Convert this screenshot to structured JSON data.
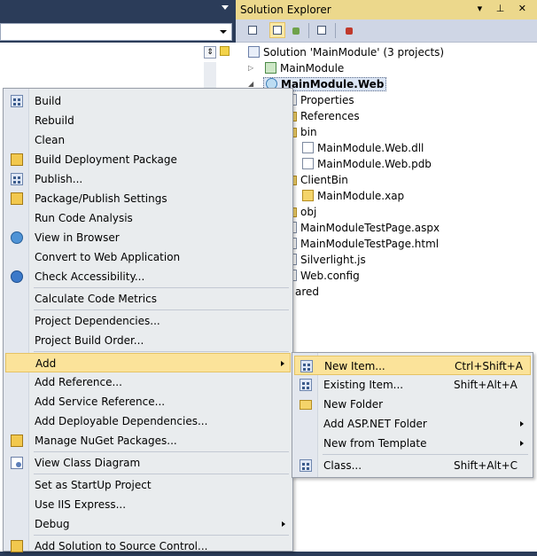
{
  "solution_explorer": {
    "title": "Solution Explorer",
    "title_buttons": "▾ ⊥ ✕",
    "tree": [
      {
        "label": "Solution 'MainModule' (3 projects)",
        "icon": "solution-icon"
      },
      {
        "label": "MainModule",
        "icon": "csharp-project-icon"
      },
      {
        "label": "MainModule.Web",
        "icon": "web-project-icon"
      },
      {
        "label": "Properties",
        "icon": "properties-icon"
      },
      {
        "label": "References",
        "icon": "references-icon"
      },
      {
        "label": "bin",
        "icon": "folder-icon"
      },
      {
        "label": "MainModule.Web.dll",
        "icon": "file-icon"
      },
      {
        "label": "MainModule.Web.pdb",
        "icon": "file-icon"
      },
      {
        "label": "ClientBin",
        "icon": "folder-icon"
      },
      {
        "label": "MainModule.xap",
        "icon": "xap-icon"
      },
      {
        "label": "obj",
        "icon": "folder-icon"
      },
      {
        "label": "MainModuleTestPage.aspx",
        "icon": "file-icon"
      },
      {
        "label": "MainModuleTestPage.html",
        "icon": "file-icon"
      },
      {
        "label": "Silverlight.js",
        "icon": "file-icon"
      },
      {
        "label": "Web.config",
        "icon": "file-icon"
      },
      {
        "label": "ared",
        "icon": "project-icon"
      }
    ]
  },
  "context_menu": {
    "items": [
      {
        "label": "Build",
        "icon": "build-icon"
      },
      {
        "label": "Rebuild"
      },
      {
        "label": "Clean"
      },
      {
        "label": "Build Deployment Package",
        "icon": "package-icon"
      },
      {
        "label": "Publish...",
        "icon": "publish-icon"
      },
      {
        "label": "Package/Publish Settings",
        "icon": "settings-icon"
      },
      {
        "label": "Run Code Analysis"
      },
      {
        "label": "View in Browser",
        "icon": "browser-icon"
      },
      {
        "label": "Convert to Web Application"
      },
      {
        "label": "Check Accessibility...",
        "icon": "accessibility-icon"
      },
      {
        "label": "Calculate Code Metrics"
      },
      {
        "label": "Project Dependencies..."
      },
      {
        "label": "Project Build Order..."
      },
      {
        "label": "Add",
        "highlighted": true,
        "submenu": true
      },
      {
        "label": "Add Reference..."
      },
      {
        "label": "Add Service Reference..."
      },
      {
        "label": "Add Deployable Dependencies..."
      },
      {
        "label": "Manage NuGet Packages...",
        "icon": "nuget-icon"
      },
      {
        "label": "View Class Diagram",
        "icon": "class-diagram-icon"
      },
      {
        "label": "Set as StartUp Project"
      },
      {
        "label": "Use IIS Express..."
      },
      {
        "label": "Debug",
        "submenu": true
      },
      {
        "label": "Add Solution to Source Control...",
        "icon": "source-control-icon"
      }
    ]
  },
  "add_submenu": {
    "items": [
      {
        "label": "New Item...",
        "shortcut": "Ctrl+Shift+A",
        "highlighted": true,
        "icon": "new-item-icon"
      },
      {
        "label": "Existing Item...",
        "shortcut": "Shift+Alt+A",
        "icon": "existing-item-icon"
      },
      {
        "label": "New Folder",
        "shortcut": "",
        "icon": "new-folder-icon"
      },
      {
        "label": "Add ASP.NET Folder",
        "shortcut": "",
        "submenu": true
      },
      {
        "label": "New from Template",
        "shortcut": "",
        "submenu": true
      },
      {
        "label": "Class...",
        "shortcut": "Shift+Alt+C",
        "icon": "class-icon"
      }
    ]
  },
  "colors": {
    "highlight": "#fbe39a",
    "title_bar": "#ecd88c",
    "menu_bg": "#e9ecee",
    "ide_bg": "#2b3c59"
  }
}
